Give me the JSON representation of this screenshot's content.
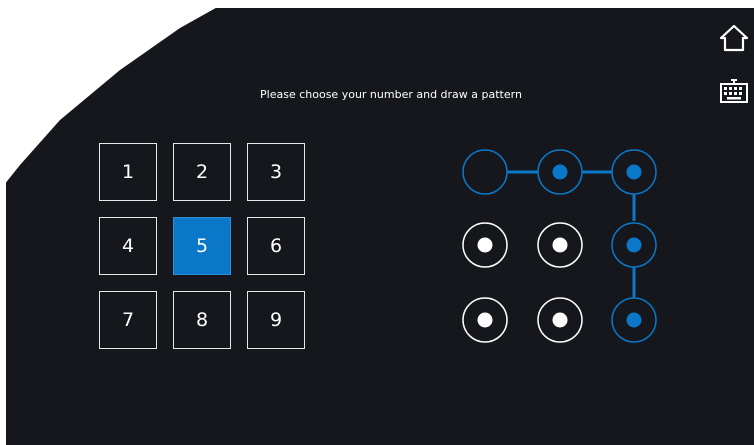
{
  "instruction": "Please choose your number and draw a pattern",
  "keypad": {
    "keys": [
      "1",
      "2",
      "3",
      "4",
      "5",
      "6",
      "7",
      "8",
      "9"
    ],
    "selected": "5"
  },
  "pattern": {
    "selected_nodes": [
      2,
      3,
      6,
      9
    ],
    "start_node": 1,
    "sequence": [
      1,
      2,
      3,
      6,
      9
    ]
  },
  "icons": {
    "home": "home-icon",
    "keyboard": "keyboard-icon"
  },
  "colors": {
    "background": "#16171c",
    "accent": "#0a77c8",
    "foreground": "#ffffff"
  }
}
